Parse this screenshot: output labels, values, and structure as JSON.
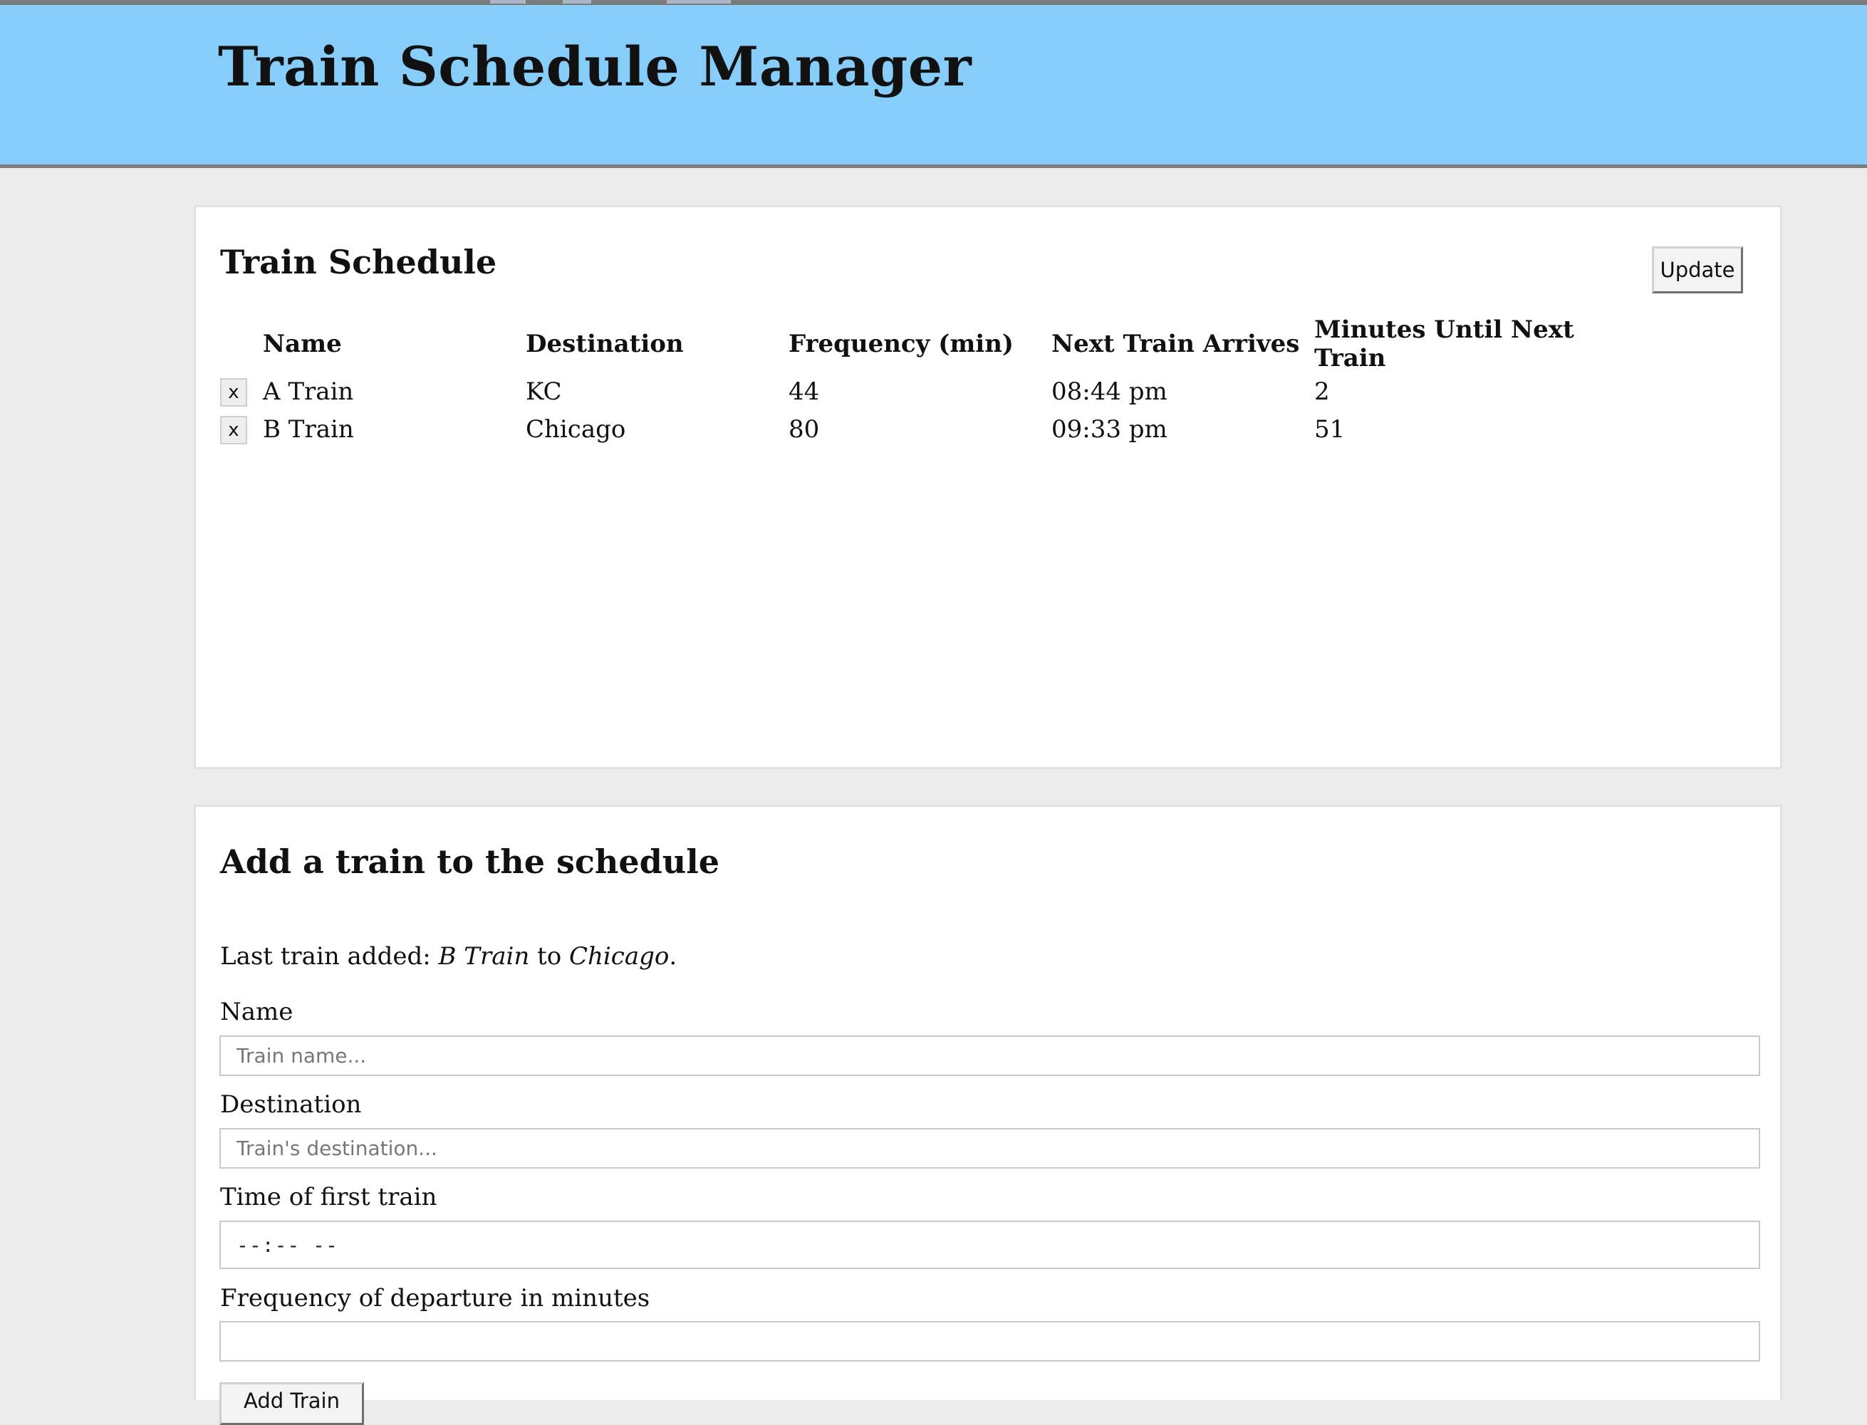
{
  "app": {
    "title": "Train Schedule Manager"
  },
  "schedule": {
    "heading": "Train Schedule",
    "update_label": "Update",
    "columns": [
      "Name",
      "Destination",
      "Frequency (min)",
      "Next Train Arrives",
      "Minutes Until Next Train"
    ],
    "rows": [
      {
        "delete_label": "x",
        "name": "A Train",
        "destination": "KC",
        "frequency": "44",
        "next_arrival": "08:44 pm",
        "minutes_away": "2"
      },
      {
        "delete_label": "x",
        "name": "B Train",
        "destination": "Chicago",
        "frequency": "80",
        "next_arrival": "09:33 pm",
        "minutes_away": "51"
      }
    ]
  },
  "add_form": {
    "heading": "Add a train to the schedule",
    "last_added": {
      "prefix": "Last train added: ",
      "name": "B Train",
      "middle": " to ",
      "destination": "Chicago",
      "suffix": "."
    },
    "name_label": "Name",
    "name_placeholder": "Train name...",
    "destination_label": "Destination",
    "destination_placeholder": "Train's destination...",
    "first_time_label": "Time of first train",
    "first_time_value": "--:-- --",
    "frequency_label": "Frequency of departure in minutes",
    "frequency_value": "",
    "submit_label": "Add Train"
  },
  "colors": {
    "banner": "#87cdfa",
    "page_background": "#ececec",
    "panel_background": "#ffffff"
  }
}
